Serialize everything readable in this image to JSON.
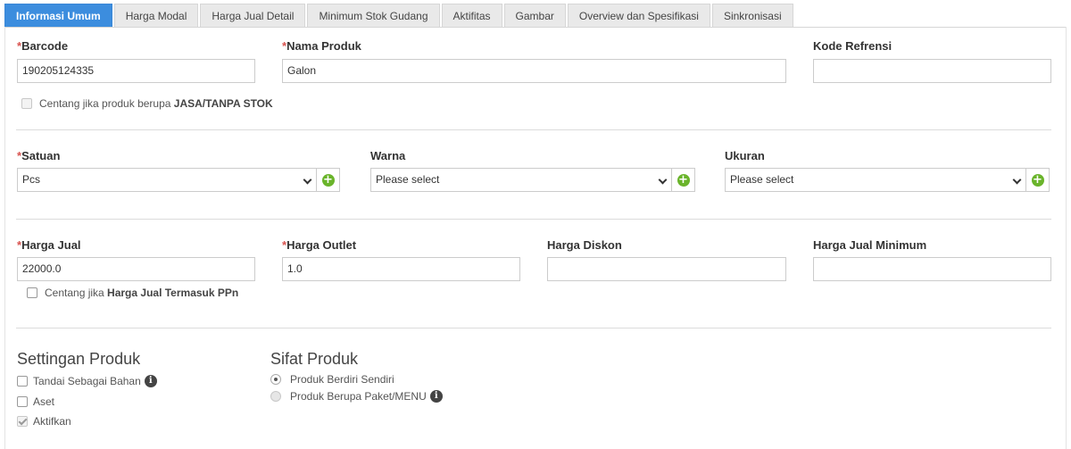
{
  "tabs": [
    {
      "label": "Informasi Umum",
      "active": true
    },
    {
      "label": "Harga Modal"
    },
    {
      "label": "Harga Jual Detail"
    },
    {
      "label": "Minimum Stok Gudang"
    },
    {
      "label": "Aktifitas"
    },
    {
      "label": "Gambar"
    },
    {
      "label": "Overview dan Spesifikasi"
    },
    {
      "label": "Sinkronisasi"
    }
  ],
  "required_mark": "*",
  "fields": {
    "barcode": {
      "label": "Barcode",
      "value": "190205124335"
    },
    "nama_produk": {
      "label": "Nama Produk",
      "value": "Galon"
    },
    "kode_refrensi": {
      "label": "Kode Refrensi",
      "value": ""
    },
    "jasa_checkbox": {
      "text": "Centang jika produk berupa ",
      "bold": "JASA/TANPA STOK"
    },
    "satuan": {
      "label": "Satuan",
      "value": "Pcs"
    },
    "warna": {
      "label": "Warna",
      "value": "Please select"
    },
    "ukuran": {
      "label": "Ukuran",
      "value": "Please select"
    },
    "harga_jual": {
      "label": "Harga Jual",
      "value": "22000.0"
    },
    "harga_outlet": {
      "label": "Harga Outlet",
      "value": "1.0"
    },
    "harga_diskon": {
      "label": "Harga Diskon",
      "value": ""
    },
    "harga_jual_minimum": {
      "label": "Harga Jual Minimum",
      "value": ""
    },
    "ppn_checkbox": {
      "text": "Centang jika ",
      "bold": "Harga Jual Termasuk PPn"
    }
  },
  "settingan": {
    "title": "Settingan Produk",
    "items": [
      {
        "label": "Tandai Sebagai Bahan",
        "checked": false
      },
      {
        "label": "Aset",
        "checked": false
      },
      {
        "label": "Aktifkan",
        "checked": true
      }
    ]
  },
  "sifat": {
    "title": "Sifat Produk",
    "options": [
      {
        "label": "Produk Berdiri Sendiri",
        "selected": true
      },
      {
        "label": "Produk Berupa Paket/MENU",
        "selected": false
      }
    ]
  },
  "icons": {
    "add": "plus-circle-icon",
    "info": "info-circle-icon",
    "dropdown": "chevron-down-icon"
  },
  "colors": {
    "tab_active": "#3c8dde",
    "required": "#d9534f",
    "add_button": "#6ab42b"
  }
}
